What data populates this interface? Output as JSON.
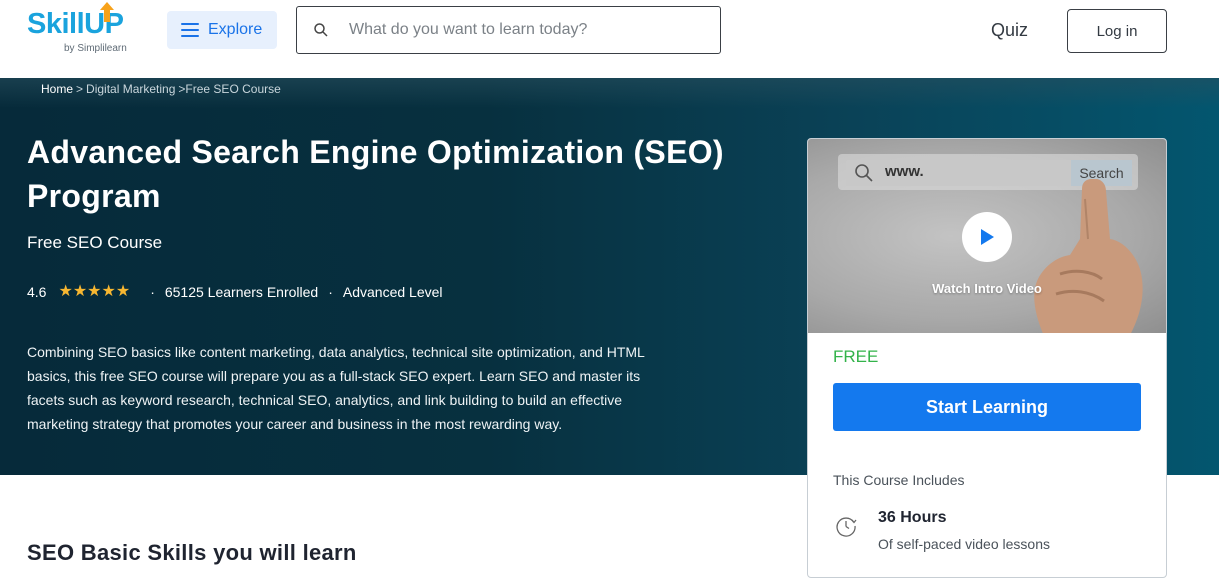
{
  "header": {
    "logo_text": "SkillUP",
    "logo_sub": "by Simplilearn",
    "explore_label": "Explore",
    "search_placeholder": "What do you want to learn today?",
    "search_value": "",
    "quiz_label": "Quiz",
    "login_label": "Log in"
  },
  "breadcrumb": {
    "items": [
      "Home",
      "Digital Marketing",
      "Free SEO Course"
    ],
    "separator": ">"
  },
  "hero": {
    "title": "Advanced Search Engine Optimization (SEO) Program",
    "subtitle": "Free SEO Course",
    "rating": "4.6",
    "rating_value": 4.6,
    "rating_max": 5,
    "learners": "65125 Learners Enrolled",
    "level": "Advanced Level",
    "description": "Combining SEO basics like content marketing, data analytics, technical site optimization, and HTML basics, this free SEO course will prepare you as a full-stack SEO expert. Learn SEO and master its facets such as keyword research, technical SEO, analytics, and link building to build an effective marketing strategy that promotes your career and business in the most rewarding way."
  },
  "card": {
    "video": {
      "thumb_url_text": "www.",
      "thumb_search_text": "Search",
      "watch_label": "Watch Intro Video"
    },
    "price": "FREE",
    "start_label": "Start Learning",
    "includes_title": "This Course Includes",
    "includes": [
      {
        "icon": "clock-icon",
        "title": "36 Hours",
        "detail": "Of self-paced video lessons"
      }
    ]
  },
  "section": {
    "title": "SEO Basic Skills you will learn"
  },
  "colors": {
    "brand_blue": "#1aa3dd",
    "accent_blue": "#1479ee",
    "free_green": "#33b34a",
    "star_gold": "#f7b731",
    "hero_dark": "#062a3a",
    "hero_teal": "#03566f"
  }
}
